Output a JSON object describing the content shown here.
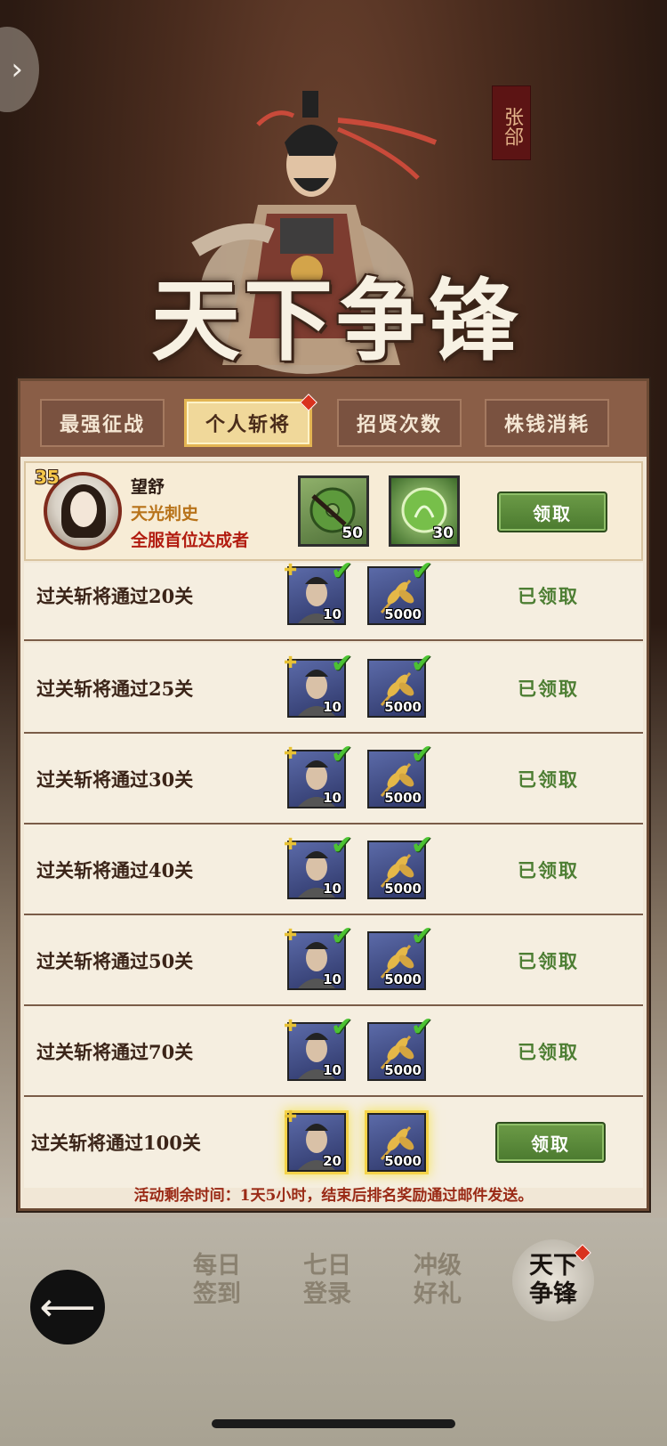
{
  "header": {
    "character_name": "张郃",
    "event_title": "天下争锋"
  },
  "tabs": [
    {
      "label": "最强征战",
      "active": false
    },
    {
      "label": "个人斩将",
      "active": true,
      "badge": true
    },
    {
      "label": "招贤次数",
      "active": false
    },
    {
      "label": "株钱消耗",
      "active": false
    }
  ],
  "top_player": {
    "level": "35",
    "name": "望舒",
    "title": "天光刺史",
    "achievement": "全服首位达成者",
    "rewards": [
      {
        "icon": "jade-coin-icon",
        "qty": "50"
      },
      {
        "icon": "green-orb-icon",
        "qty": "30"
      }
    ],
    "button_label": "领取"
  },
  "tasks": [
    {
      "label": "过关斩将通过20关",
      "rewards": [
        {
          "icon": "general-portrait-icon",
          "qty": "10"
        },
        {
          "icon": "wheat-icon",
          "qty": "5000"
        }
      ],
      "status": "已领取",
      "claimed": true
    },
    {
      "label": "过关斩将通过25关",
      "rewards": [
        {
          "icon": "general-portrait-icon",
          "qty": "10"
        },
        {
          "icon": "wheat-icon",
          "qty": "5000"
        }
      ],
      "status": "已领取",
      "claimed": true
    },
    {
      "label": "过关斩将通过30关",
      "rewards": [
        {
          "icon": "general-portrait-icon",
          "qty": "10"
        },
        {
          "icon": "wheat-icon",
          "qty": "5000"
        }
      ],
      "status": "已领取",
      "claimed": true
    },
    {
      "label": "过关斩将通过40关",
      "rewards": [
        {
          "icon": "general-portrait-icon",
          "qty": "10"
        },
        {
          "icon": "wheat-icon",
          "qty": "5000"
        }
      ],
      "status": "已领取",
      "claimed": true
    },
    {
      "label": "过关斩将通过50关",
      "rewards": [
        {
          "icon": "general-portrait-icon",
          "qty": "10"
        },
        {
          "icon": "wheat-icon",
          "qty": "5000"
        }
      ],
      "status": "已领取",
      "claimed": true
    },
    {
      "label": "过关斩将通过70关",
      "rewards": [
        {
          "icon": "general-portrait-icon",
          "qty": "10"
        },
        {
          "icon": "wheat-icon",
          "qty": "5000"
        }
      ],
      "status": "已领取",
      "claimed": true
    },
    {
      "label": "过关斩将通过100关",
      "rewards": [
        {
          "icon": "general-portrait-icon",
          "qty": "20"
        },
        {
          "icon": "wheat-icon",
          "qty": "5000"
        }
      ],
      "status": "领取",
      "claimed": false
    }
  ],
  "footer_note": "活动剩余时间：1天5小时，结束后排名奖励通过邮件发送。",
  "nav": {
    "items": [
      {
        "line1": "每日",
        "line2": "签到",
        "active": false
      },
      {
        "line1": "七日",
        "line2": "登录",
        "active": false
      },
      {
        "line1": "冲级",
        "line2": "好礼",
        "active": false
      },
      {
        "line1": "天下",
        "line2": "争锋",
        "active": true
      }
    ]
  },
  "colors": {
    "accent_green": "#4d7e33",
    "accent_red": "#b21c10",
    "title_gold": "#b8731a"
  }
}
